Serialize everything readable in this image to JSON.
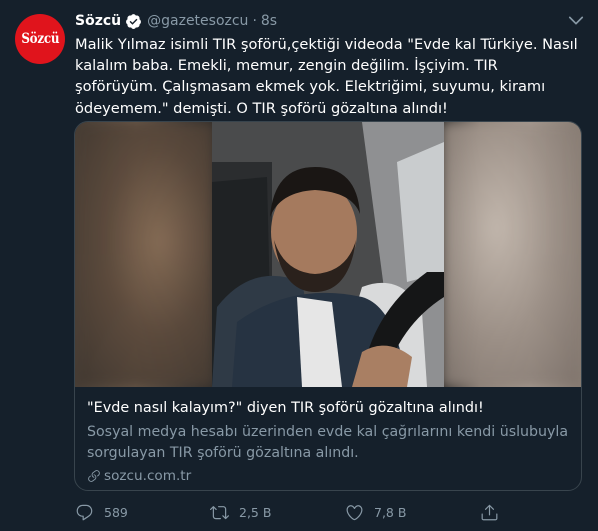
{
  "tweet": {
    "avatar_text": "Sözcü",
    "name": "Sözcü",
    "handle": "@gazetesozcu",
    "separator": "·",
    "time": "8s",
    "text": "Malik Yılmaz isimli TIR şoförü,çektiği videoda  \"Evde kal Türkiye. Nasıl kalalım baba. Emekli, memur, zengin değilim. İşçiyim. TIR şoförüyüm. Çalışmasam ekmek yok. Elektriğimi, suyumu, kiramı ödeyemem.\" demişti. O TIR şoförü gözaltına alındı!"
  },
  "card": {
    "title": "\"Evde nasıl kalayım?\" diyen TIR şoförü gözaltına alındı!",
    "description": "Sosyal medya hesabı üzerinden evde kal çağrılarını kendi üslubuyla sorgulayan TIR şoförü gözaltına alındı.",
    "domain": "sozcu.com.tr"
  },
  "actions": {
    "reply_count": "589",
    "retweet_count": "2,5 B",
    "like_count": "7,8 B"
  },
  "icons": {
    "verified": "verified-badge-icon",
    "caret": "chevron-down-icon",
    "link": "link-icon",
    "reply": "reply-icon",
    "retweet": "retweet-icon",
    "like": "heart-icon",
    "share": "share-icon"
  },
  "colors": {
    "background": "#15202b",
    "secondary_text": "#8899a6",
    "border": "#38444d",
    "brand_red": "#e0141c"
  }
}
